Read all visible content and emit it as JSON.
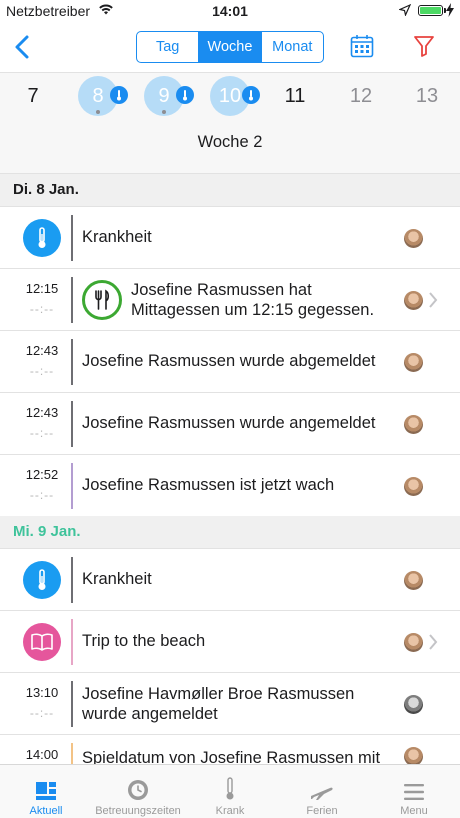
{
  "status_bar": {
    "carrier": "Netzbetreiber",
    "time": "14:01"
  },
  "nav": {
    "segments": [
      "Tag",
      "Woche",
      "Monat"
    ],
    "active_segment": "Woche"
  },
  "week_strip": {
    "days": [
      {
        "number": "7",
        "state": "normal",
        "has_badge": false
      },
      {
        "number": "8",
        "state": "highlight",
        "has_badge": true
      },
      {
        "number": "9",
        "state": "highlight",
        "has_badge": true
      },
      {
        "number": "10",
        "state": "highlight",
        "has_badge": true
      },
      {
        "number": "11",
        "state": "normal",
        "has_badge": false
      },
      {
        "number": "12",
        "state": "dim",
        "has_badge": false
      },
      {
        "number": "13",
        "state": "dim",
        "has_badge": false
      }
    ],
    "week_label": "Woche 2"
  },
  "sections": [
    {
      "title": "Di. 8 Jan.",
      "rows": [
        {
          "type": "icon",
          "icon": "thermometer-icon",
          "text": "Krankheit"
        },
        {
          "type": "time",
          "start": "12:15",
          "end": "--:--",
          "icon": "fork-knife-icon",
          "text_line1": "Josefine Rasmussen hat",
          "text_line2": "Mittagessen um 12:15 gegessen."
        },
        {
          "type": "time",
          "start": "12:43",
          "end": "--:--",
          "text": "Josefine Rasmussen wurde abgemeldet"
        },
        {
          "type": "time",
          "start": "12:43",
          "end": "--:--",
          "text": "Josefine Rasmussen wurde angemeldet"
        },
        {
          "type": "time",
          "start": "12:52",
          "end": "--:--",
          "text": "Josefine Rasmussen ist jetzt wach"
        }
      ]
    },
    {
      "title": "Mi. 9 Jan.",
      "rows": [
        {
          "type": "icon",
          "icon": "thermometer-icon",
          "text": "Krankheit"
        },
        {
          "type": "icon",
          "icon": "book-icon",
          "text": "Trip to the beach"
        },
        {
          "type": "time",
          "start": "13:10",
          "end": "--:--",
          "text_line1": "Josefine Havmøller Broe Rasmussen",
          "text_line2": "wurde angemeldet"
        },
        {
          "type": "time",
          "start": "14:00",
          "text": "Spieldatum von Josefine Rasmussen mit"
        }
      ]
    }
  ],
  "tab_bar": {
    "tabs": [
      {
        "label": "Aktuell",
        "icon": "dashboard-icon",
        "active": true
      },
      {
        "label": "Betreuungszeiten",
        "icon": "clock-icon",
        "active": false
      },
      {
        "label": "Krank",
        "icon": "thermometer-icon",
        "active": false
      },
      {
        "label": "Ferien",
        "icon": "airplane-icon",
        "active": false
      },
      {
        "label": "Menu",
        "icon": "menu-icon",
        "active": false
      }
    ]
  },
  "colors": {
    "accent": "#1a8cf0",
    "section_green": "#3fc39b",
    "sick_blue": "#1a9cf1",
    "activity_pink": "#e5569c",
    "meal_green": "#3ca832"
  }
}
